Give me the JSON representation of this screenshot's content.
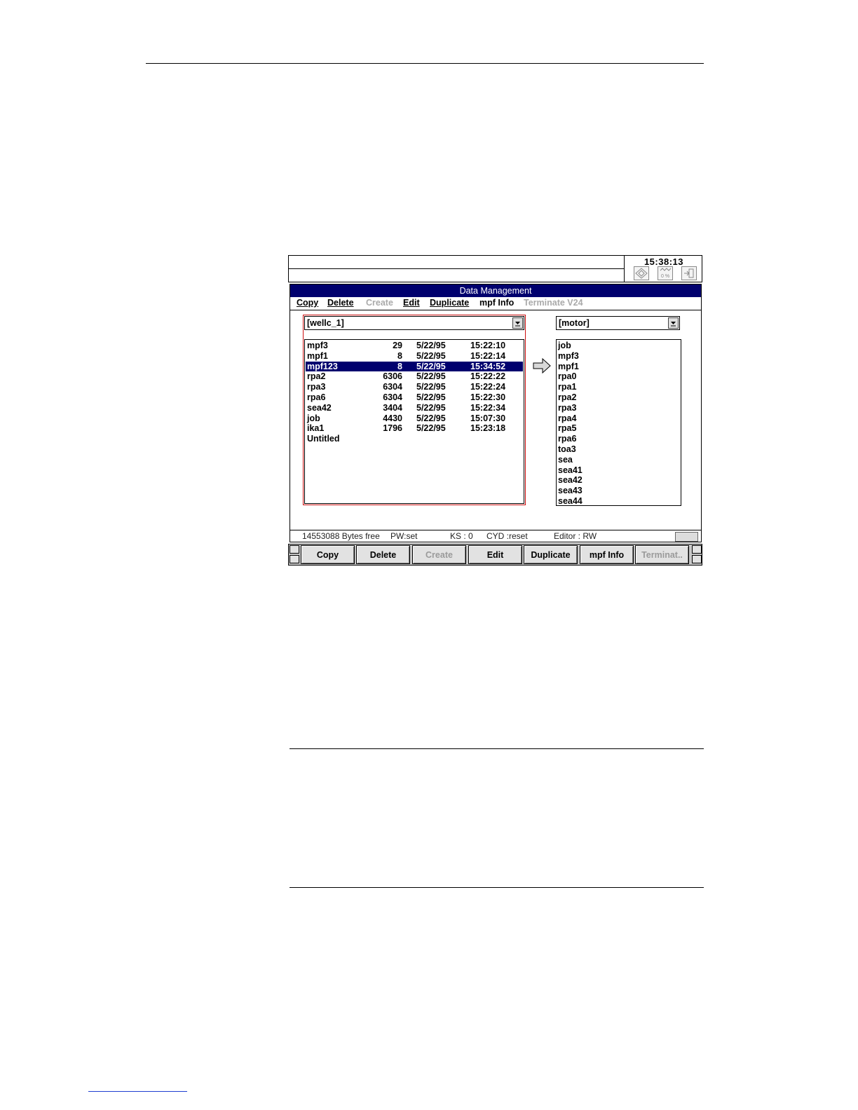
{
  "clock": "15:38:13",
  "window": {
    "title": "Data Management"
  },
  "menu": [
    {
      "label": "Copy",
      "disabled": false
    },
    {
      "label": "Delete",
      "disabled": false
    },
    {
      "label": "Create",
      "disabled": true
    },
    {
      "label": "Edit",
      "disabled": false
    },
    {
      "label": "Duplicate",
      "disabled": false
    },
    {
      "label": "mpf Info",
      "disabled": false
    },
    {
      "label": "Terminate V24",
      "disabled": true
    }
  ],
  "source": {
    "selected": "[wellc_1]",
    "files": [
      {
        "name": "mpf3",
        "size": "29",
        "date": "5/22/95",
        "time": "15:22:10"
      },
      {
        "name": "mpf1",
        "size": "8",
        "date": "5/22/95",
        "time": "15:22:14"
      },
      {
        "name": "mpf123",
        "size": "8",
        "date": "5/22/95",
        "time": "15:34:52",
        "selected": true
      },
      {
        "name": "rpa2",
        "size": "6306",
        "date": "5/22/95",
        "time": "15:22:22"
      },
      {
        "name": "rpa3",
        "size": "6304",
        "date": "5/22/95",
        "time": "15:22:24"
      },
      {
        "name": "rpa6",
        "size": "6304",
        "date": "5/22/95",
        "time": "15:22:30"
      },
      {
        "name": "sea42",
        "size": "3404",
        "date": "5/22/95",
        "time": "15:22:34"
      },
      {
        "name": "job",
        "size": "4430",
        "date": "5/22/95",
        "time": "15:07:30"
      },
      {
        "name": "ika1",
        "size": "1796",
        "date": "5/22/95",
        "time": "15:23:18"
      },
      {
        "name": "Untitled",
        "size": "",
        "date": "",
        "time": ""
      }
    ]
  },
  "target": {
    "selected": "[motor]",
    "files": [
      "job",
      "mpf3",
      "mpf1",
      "rpa0",
      "rpa1",
      "rpa2",
      "rpa3",
      "rpa4",
      "rpa5",
      "rpa6",
      "toa3",
      "sea",
      "sea41",
      "sea42",
      "sea43",
      "sea44"
    ]
  },
  "status": {
    "bytes_free": "14553088 Bytes free",
    "pw": "PW:set",
    "ks": "KS : 0",
    "cyd": "CYD :reset",
    "editor": "Editor : RW"
  },
  "softkeys": [
    {
      "label": "Copy",
      "disabled": false
    },
    {
      "label": "Delete",
      "disabled": false
    },
    {
      "label": "Create",
      "disabled": true
    },
    {
      "label": "Edit",
      "disabled": false
    },
    {
      "label": "Duplicate",
      "disabled": false
    },
    {
      "label": "mpf Info",
      "disabled": false
    },
    {
      "label": "Terminat..",
      "disabled": true
    }
  ],
  "colors": {
    "titlebar": "#00006e",
    "focus_border": "#cc1010",
    "disabled_text": "#aaaaaa"
  }
}
